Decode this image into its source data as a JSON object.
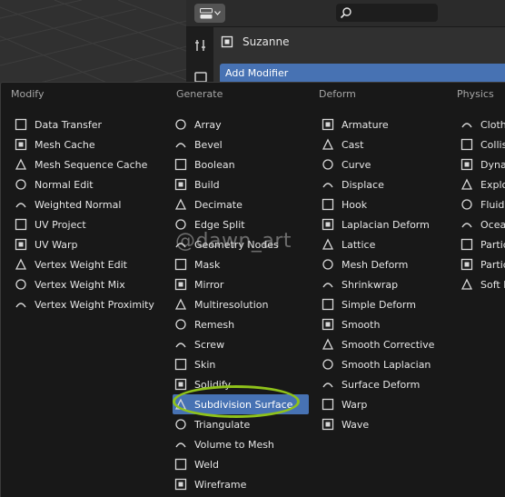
{
  "properties": {
    "object_name": "Suzanne",
    "add_modifier_label": "Add Modifier"
  },
  "menu": {
    "columns": [
      {
        "header": "Modify",
        "items": [
          {
            "label": "Data Transfer",
            "icon": "data-transfer-icon"
          },
          {
            "label": "Mesh Cache",
            "icon": "mesh-cache-icon"
          },
          {
            "label": "Mesh Sequence Cache",
            "icon": "mesh-sequence-cache-icon"
          },
          {
            "label": "Normal Edit",
            "icon": "normal-edit-icon"
          },
          {
            "label": "Weighted Normal",
            "icon": "weighted-normal-icon"
          },
          {
            "label": "UV Project",
            "icon": "uv-project-icon"
          },
          {
            "label": "UV Warp",
            "icon": "uv-warp-icon"
          },
          {
            "label": "Vertex Weight Edit",
            "icon": "vertex-weight-edit-icon"
          },
          {
            "label": "Vertex Weight Mix",
            "icon": "vertex-weight-mix-icon"
          },
          {
            "label": "Vertex Weight Proximity",
            "icon": "vertex-weight-proximity-icon"
          }
        ]
      },
      {
        "header": "Generate",
        "items": [
          {
            "label": "Array",
            "icon": "array-icon"
          },
          {
            "label": "Bevel",
            "icon": "bevel-icon"
          },
          {
            "label": "Boolean",
            "icon": "boolean-icon"
          },
          {
            "label": "Build",
            "icon": "build-icon"
          },
          {
            "label": "Decimate",
            "icon": "decimate-icon"
          },
          {
            "label": "Edge Split",
            "icon": "edge-split-icon"
          },
          {
            "label": "Geometry Nodes",
            "icon": "geometry-nodes-icon"
          },
          {
            "label": "Mask",
            "icon": "mask-icon"
          },
          {
            "label": "Mirror",
            "icon": "mirror-icon"
          },
          {
            "label": "Multiresolution",
            "icon": "multiresolution-icon"
          },
          {
            "label": "Remesh",
            "icon": "remesh-icon"
          },
          {
            "label": "Screw",
            "icon": "screw-icon"
          },
          {
            "label": "Skin",
            "icon": "skin-icon"
          },
          {
            "label": "Solidify",
            "icon": "solidify-icon"
          },
          {
            "label": "Subdivision Surface",
            "icon": "subdivision-surface-icon",
            "active": true
          },
          {
            "label": "Triangulate",
            "icon": "triangulate-icon"
          },
          {
            "label": "Volume to Mesh",
            "icon": "volume-to-mesh-icon"
          },
          {
            "label": "Weld",
            "icon": "weld-icon"
          },
          {
            "label": "Wireframe",
            "icon": "wireframe-icon"
          }
        ]
      },
      {
        "header": "Deform",
        "items": [
          {
            "label": "Armature",
            "icon": "armature-icon"
          },
          {
            "label": "Cast",
            "icon": "cast-icon"
          },
          {
            "label": "Curve",
            "icon": "curve-icon"
          },
          {
            "label": "Displace",
            "icon": "displace-icon"
          },
          {
            "label": "Hook",
            "icon": "hook-icon"
          },
          {
            "label": "Laplacian Deform",
            "icon": "laplacian-deform-icon"
          },
          {
            "label": "Lattice",
            "icon": "lattice-icon"
          },
          {
            "label": "Mesh Deform",
            "icon": "mesh-deform-icon"
          },
          {
            "label": "Shrinkwrap",
            "icon": "shrinkwrap-icon"
          },
          {
            "label": "Simple Deform",
            "icon": "simple-deform-icon"
          },
          {
            "label": "Smooth",
            "icon": "smooth-icon"
          },
          {
            "label": "Smooth Corrective",
            "icon": "smooth-corrective-icon"
          },
          {
            "label": "Smooth Laplacian",
            "icon": "smooth-laplacian-icon"
          },
          {
            "label": "Surface Deform",
            "icon": "surface-deform-icon"
          },
          {
            "label": "Warp",
            "icon": "warp-icon"
          },
          {
            "label": "Wave",
            "icon": "wave-icon"
          }
        ]
      },
      {
        "header": "Physics",
        "items": [
          {
            "label": "Cloth",
            "icon": "cloth-icon"
          },
          {
            "label": "Collisi",
            "icon": "collision-icon"
          },
          {
            "label": "Dynar",
            "icon": "dynamic-paint-icon"
          },
          {
            "label": "Explo",
            "icon": "explode-icon"
          },
          {
            "label": "Fluid",
            "icon": "fluid-icon"
          },
          {
            "label": "Ocean",
            "icon": "ocean-icon"
          },
          {
            "label": "Partic",
            "icon": "particle-instance-icon"
          },
          {
            "label": "Partic",
            "icon": "particle-system-icon"
          },
          {
            "label": "Soft B",
            "icon": "soft-body-icon"
          }
        ]
      }
    ]
  },
  "watermark": "@dawn_art",
  "colors": {
    "accent": "#4772b3",
    "highlight_ring": "#8fc21a",
    "menu_bg": "#181818"
  }
}
